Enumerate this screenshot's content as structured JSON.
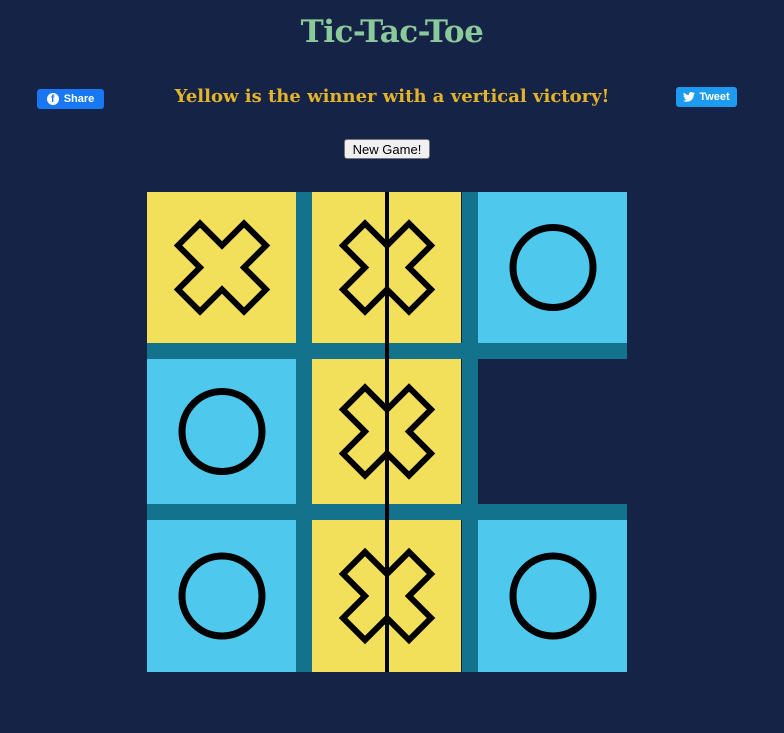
{
  "title": "Tic-Tac-Toe",
  "status": "Yellow is the winner with a vertical victory!",
  "buttons": {
    "facebook_share": "Share",
    "twitter_tweet": "Tweet",
    "new_game": "New Game!"
  },
  "icons": {
    "facebook": "facebook-icon",
    "twitter": "twitter-icon"
  },
  "colors": {
    "background": "#152347",
    "title": "#8ac99a",
    "status": "#e3b32a",
    "yellow_player": "#f2e05a",
    "blue_player": "#4ec8ec",
    "grid_lines": "#13738c",
    "facebook": "#1877f2",
    "twitter": "#1d9bf0"
  },
  "board": {
    "cells": [
      [
        "X",
        "X",
        "O"
      ],
      [
        "O",
        "X",
        ""
      ],
      [
        "O",
        "X",
        "O"
      ]
    ],
    "winner": "Yellow",
    "victory": "vertical",
    "winning_column": 1
  }
}
